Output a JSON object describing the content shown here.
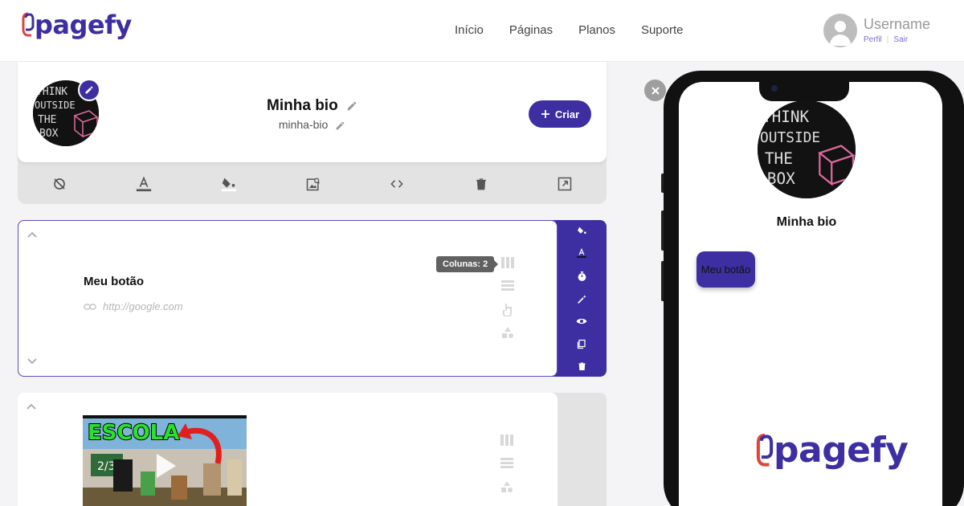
{
  "app": {
    "logo_text": "pagefy"
  },
  "nav": {
    "items": [
      "Início",
      "Páginas",
      "Planos",
      "Suporte"
    ]
  },
  "user": {
    "name": "Username",
    "profile_link": "Perfil",
    "logout_link": "Sair"
  },
  "profile": {
    "bio_title": "Minha bio",
    "slug": "minha-bio",
    "create_button": "Criar",
    "avatar_art_text": [
      "THINK",
      "OUTSIDE",
      "THE",
      "BOX"
    ]
  },
  "toolbar_icons": [
    "hide-icon",
    "text-color-icon",
    "fill-color-icon",
    "image-search-icon",
    "code-icon",
    "trash-icon",
    "open-external-icon"
  ],
  "block_button": {
    "title": "Meu botão",
    "link_placeholder": "http://google.com",
    "tooltip": "Colunas: 2",
    "side_icons": [
      "fill-color-icon",
      "text-color-icon",
      "timer-icon",
      "magic-wand-icon",
      "eye-icon",
      "duplicate-icon",
      "trash-icon"
    ]
  },
  "block_video": {
    "thumbnail_title": "ESCOLA",
    "thumbnail_fraction": "2/3"
  },
  "preview": {
    "bio_title": "Minha bio",
    "button_label": "Meu botão",
    "footer_logo": "pagefy"
  },
  "colors": {
    "accent": "#3d2fa1",
    "logo_link_red": "#e0443b"
  }
}
